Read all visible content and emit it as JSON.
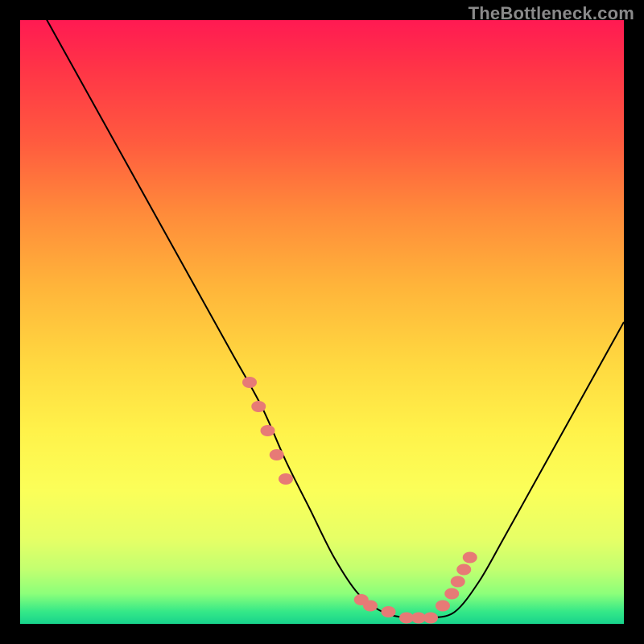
{
  "watermark": "TheBottleneck.com",
  "colors": {
    "page_bg": "#000000",
    "curve_stroke": "#000000",
    "marker_fill": "#e77a76",
    "watermark": "#8a8a8a"
  },
  "chart_data": {
    "type": "line",
    "title": "",
    "xlabel": "",
    "ylabel": "",
    "xlim": [
      0,
      100
    ],
    "ylim": [
      0,
      100
    ],
    "grid": false,
    "series": [
      {
        "name": "bottleneck-curve",
        "x": [
          0,
          5,
          10,
          15,
          20,
          25,
          30,
          35,
          40,
          44,
          48,
          52,
          56,
          60,
          64,
          68,
          72,
          76,
          80,
          85,
          90,
          95,
          100
        ],
        "values": [
          108,
          99,
          90,
          81,
          72,
          63,
          54,
          45,
          36,
          27,
          19,
          11,
          5,
          2,
          1,
          1,
          2,
          7,
          14,
          23,
          32,
          41,
          50
        ]
      }
    ],
    "markers": {
      "name": "highlight-points",
      "x": [
        38,
        39.5,
        41,
        42.5,
        44,
        56.5,
        58,
        61,
        64,
        66,
        68,
        70,
        71.5,
        72.5,
        73.5,
        74.5
      ],
      "values": [
        40,
        36,
        32,
        28,
        24,
        4,
        3,
        2,
        1,
        1,
        1,
        3,
        5,
        7,
        9,
        11
      ]
    }
  }
}
